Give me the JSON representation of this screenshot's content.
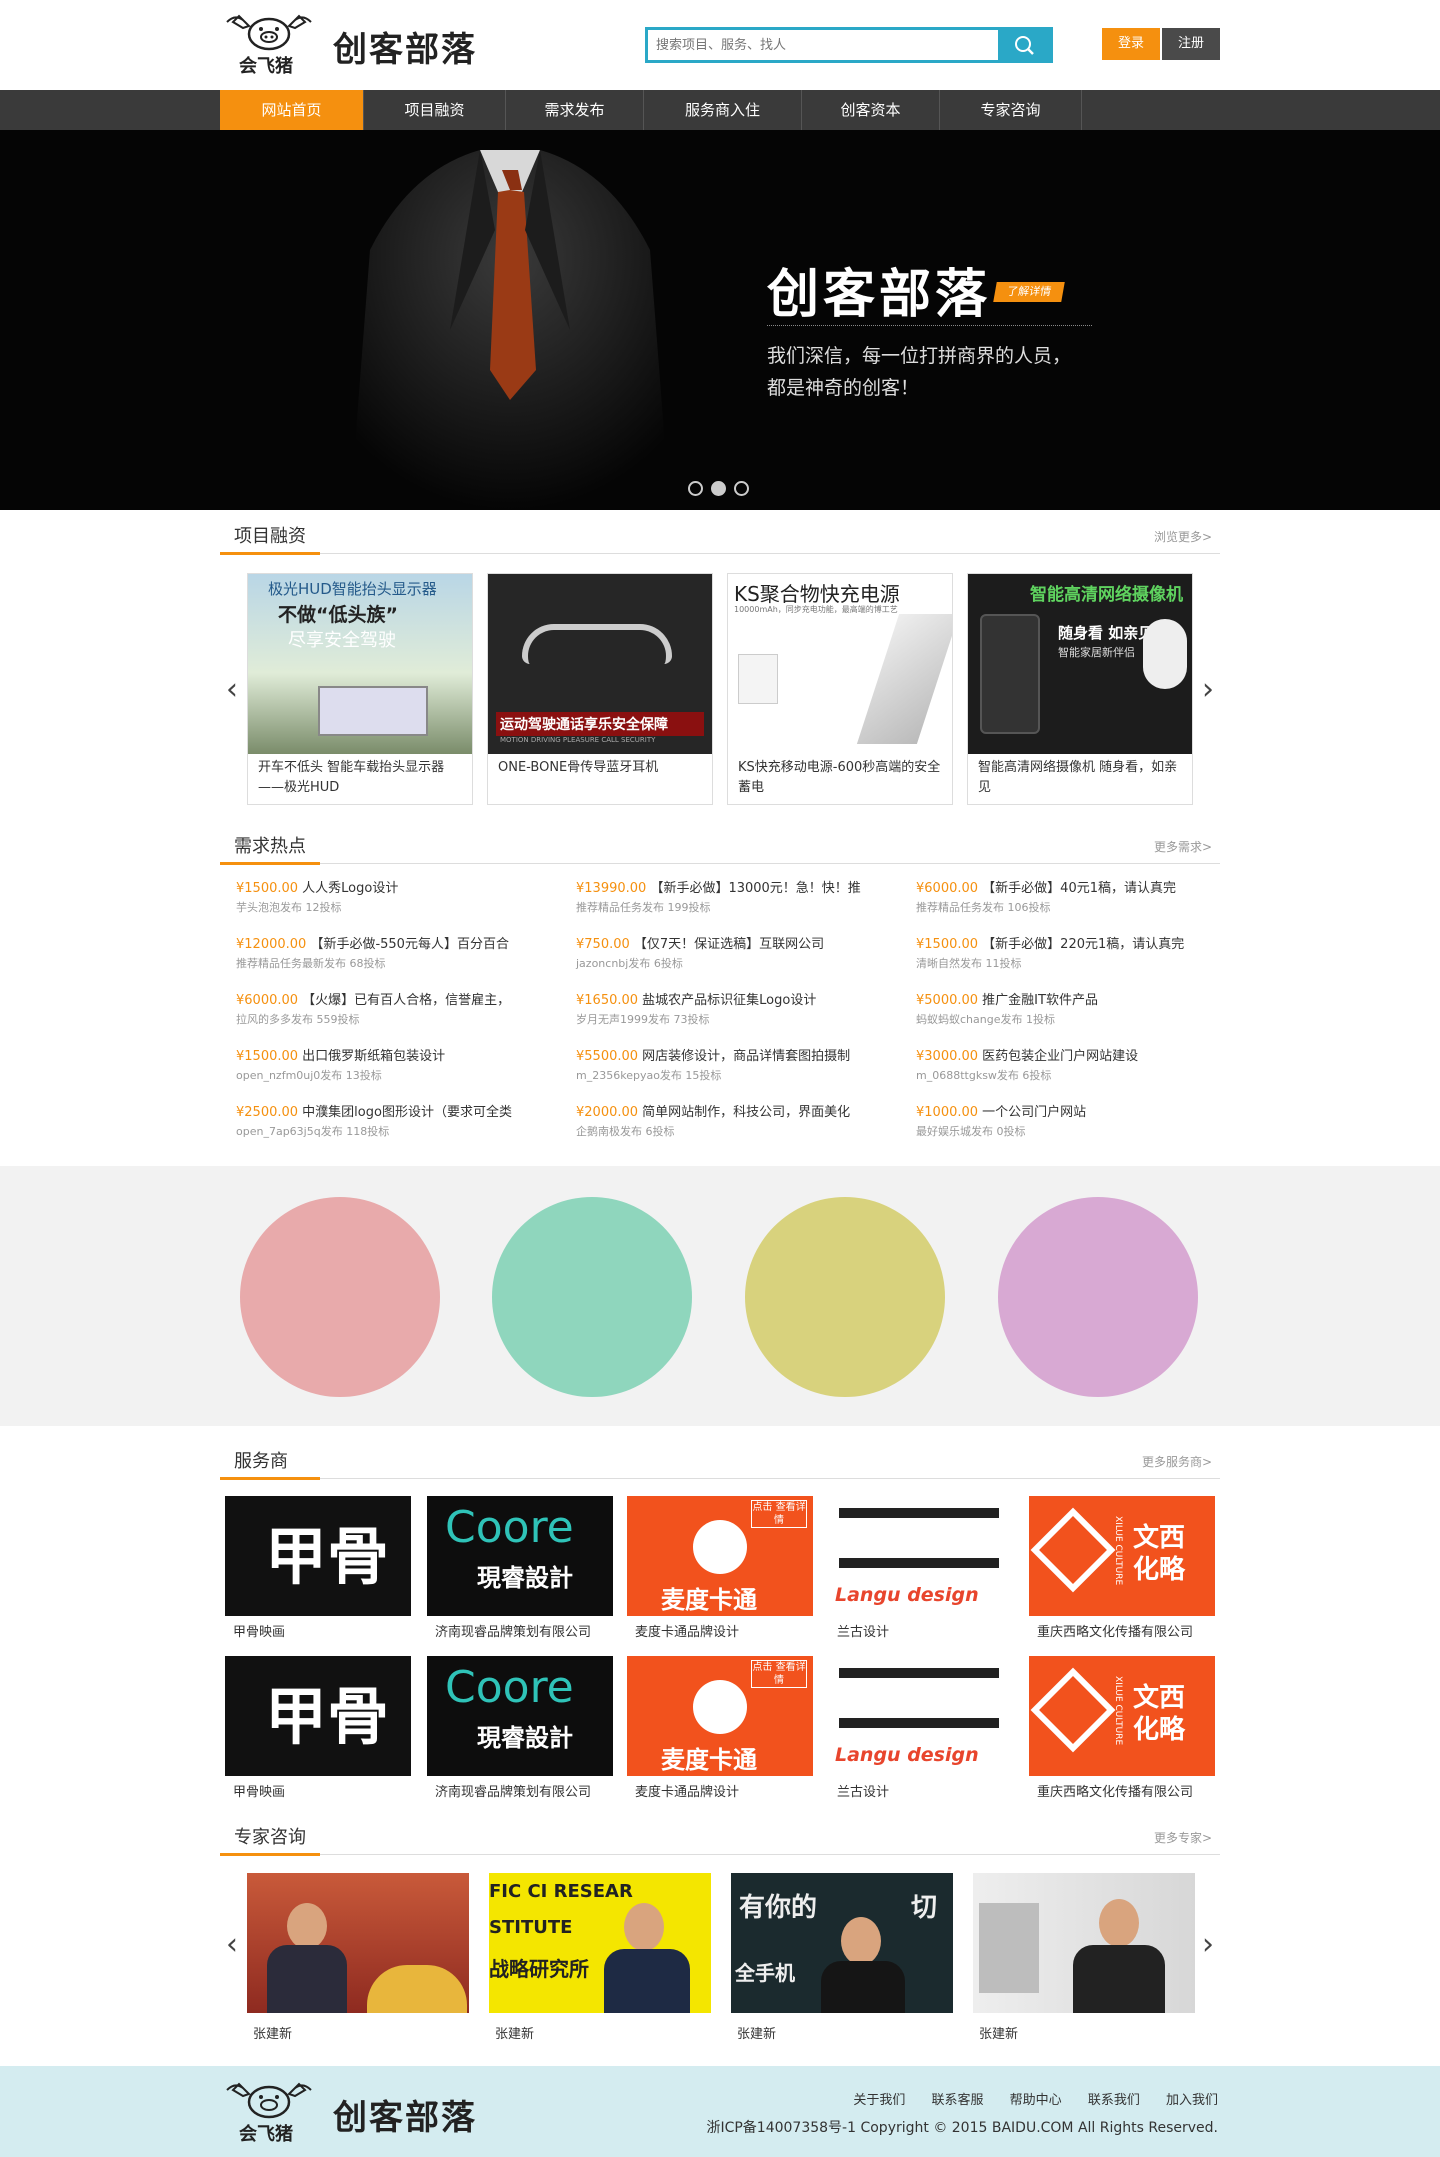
{
  "header": {
    "logo_text": "会飞猪",
    "site_name": "创客部落",
    "search_placeholder": "搜索项目、服务、找人",
    "login_label": "登录",
    "register_label": "注册"
  },
  "nav": {
    "items": [
      "网站首页",
      "项目融资",
      "需求发布",
      "服务商入住",
      "创客资本",
      "专家咨询"
    ],
    "active": "网站首页"
  },
  "banner": {
    "title": "创客部落",
    "tag": "了解详情",
    "text_line1": "我们深信，每一位打拼商界的人员，",
    "text_line2": "都是神奇的创客！"
  },
  "projects": {
    "title": "项目融资",
    "more": "浏览更多>",
    "items": [
      {
        "caption": "开车不低头 智能车载抬头显示器——极光HUD",
        "img_text_1": "极光HUD智能抬头显示器",
        "img_text_2": "不做“低头族”",
        "img_text_3": "尽享安全驾驶"
      },
      {
        "caption": "ONE-BONE骨传导蓝牙耳机",
        "img_text_1": "运动驾驶通话享乐安全保障",
        "img_text_2": "MOTION DRIVING PLEASURE CALL SECURITY"
      },
      {
        "caption": "KS快充移动电源-600秒高端的安全蓄电",
        "img_text_1": "KS聚合物快充电源",
        "img_text_2": "10000mAh，同步充电功能，最高端的博工艺"
      },
      {
        "caption": "智能高清网络摄像机 随身看，如亲见",
        "img_text_1": "智能高清网络摄像机",
        "img_text_2": "随身看 如亲见",
        "img_text_3": "智能家居新伴侣"
      }
    ]
  },
  "demands": {
    "title": "需求热点",
    "more": "更多需求>",
    "items": [
      {
        "price": "¥1500.00",
        "title": "人人秀Logo设计",
        "meta": "芋头泡泡发布  12投标"
      },
      {
        "price": "¥13990.00",
        "title": "【新手必做】13000元！急！快！推",
        "meta": "推荐精品任务发布  199投标"
      },
      {
        "price": "¥6000.00",
        "title": "【新手必做】40元1稿，请认真完",
        "meta": "推荐精品任务发布  106投标"
      },
      {
        "price": "¥12000.00",
        "title": "【新手必做-550元每人】百分百合",
        "meta": "推荐精品任务最新发布  68投标"
      },
      {
        "price": "¥750.00",
        "title": "【仅7天！保证选稿】互联网公司",
        "meta": "jazoncnbj发布  6投标"
      },
      {
        "price": "¥1500.00",
        "title": "【新手必做】220元1稿，请认真完",
        "meta": "清晰自然发布  11投标"
      },
      {
        "price": "¥6000.00",
        "title": "【火爆】已有百人合格，信誉雇主，",
        "meta": "拉风的多多发布  559投标"
      },
      {
        "price": "¥1650.00",
        "title": "盐城农产品标识征集Logo设计",
        "meta": "岁月无声1999发布  73投标"
      },
      {
        "price": "¥5000.00",
        "title": "推广金融IT软件产品",
        "meta": "蚂蚁蚂蚁change发布  1投标"
      },
      {
        "price": "¥1500.00",
        "title": "出口俄罗斯纸箱包装设计",
        "meta": "open_nzfm0uj0发布  13投标"
      },
      {
        "price": "¥5500.00",
        "title": "网店装修设计，商品详情套图拍摄制",
        "meta": "m_2356kepyao发布  15投标"
      },
      {
        "price": "¥3000.00",
        "title": "医药包装企业门户网站建设",
        "meta": "m_0688ttgksw发布  6投标"
      },
      {
        "price": "¥2500.00",
        "title": "中濮集团logo图形设计（要求可全类",
        "meta": "open_7ap63j5q发布  118投标"
      },
      {
        "price": "¥2000.00",
        "title": "简单网站制作，科技公司，界面美化",
        "meta": "企鹅南极发布  6投标"
      },
      {
        "price": "¥1000.00",
        "title": "一个公司门户网站",
        "meta": "最好娱乐城发布  0投标"
      }
    ]
  },
  "circles": {
    "colors": [
      "#e8aaab",
      "#8fd6bd",
      "#d8d27d",
      "#d8a9d3"
    ]
  },
  "providers": {
    "title": "服务商",
    "more": "更多服务商>",
    "rows": [
      [
        {
          "name": "甲骨映画",
          "logo": "甲骨",
          "bg": "#111111"
        },
        {
          "name": "济南现睿品牌策划有限公司",
          "logo": "Coore",
          "logo_sub": "現睿設計",
          "bg": "#0d0d0d"
        },
        {
          "name": "麦度卡通品牌设计",
          "logo": "麦度卡通",
          "logo_badge": "点击 查看详情",
          "bg": "#f2521d"
        },
        {
          "name": "兰古设计",
          "logo": "Langu design",
          "bg": "#ffffff"
        },
        {
          "name": "重庆西略文化传播有限公司",
          "logo": "文西 化略",
          "logo_sub": "XILUE CULTURE",
          "bg": "#f2521d"
        }
      ],
      [
        {
          "name": "甲骨映画",
          "logo": "甲骨",
          "bg": "#111111"
        },
        {
          "name": "济南现睿品牌策划有限公司",
          "logo": "Coore",
          "logo_sub": "現睿設計",
          "bg": "#0d0d0d"
        },
        {
          "name": "麦度卡通品牌设计",
          "logo": "麦度卡通",
          "logo_badge": "点击 查看详情",
          "bg": "#f2521d"
        },
        {
          "name": "兰古设计",
          "logo": "Langu design",
          "bg": "#ffffff"
        },
        {
          "name": "重庆西略文化传播有限公司",
          "logo": "文西 化略",
          "logo_sub": "XILUE CULTURE",
          "bg": "#f2521d"
        }
      ]
    ]
  },
  "experts": {
    "title": "专家咨询",
    "more": "更多专家>",
    "items": [
      {
        "name": "张建新"
      },
      {
        "name": "张建新",
        "img_text_1": "FIC CI RESEAR",
        "img_text_2": "STITUTE",
        "img_text_3": "战略研究所"
      },
      {
        "name": "张建新",
        "img_text_1": "有你的",
        "img_text_2": "全手机",
        "img_text_3": "切"
      },
      {
        "name": "张建新"
      }
    ]
  },
  "footer": {
    "logo_text": "会飞猪",
    "site_name": "创客部落",
    "links": [
      "关于我们",
      "联系客服",
      "帮助中心",
      "联系我们",
      "加入我们"
    ],
    "copyright": "浙ICP备14007358号-1   Copyright © 2015 BAIDU.COM All Rights Reserved."
  },
  "colors": {
    "accent": "#f5900f",
    "nav_bg": "#3a3a3a",
    "search_border": "#2aa8c7",
    "footer_bg": "#d4ecf0",
    "band_bg": "#f2f2f2"
  }
}
